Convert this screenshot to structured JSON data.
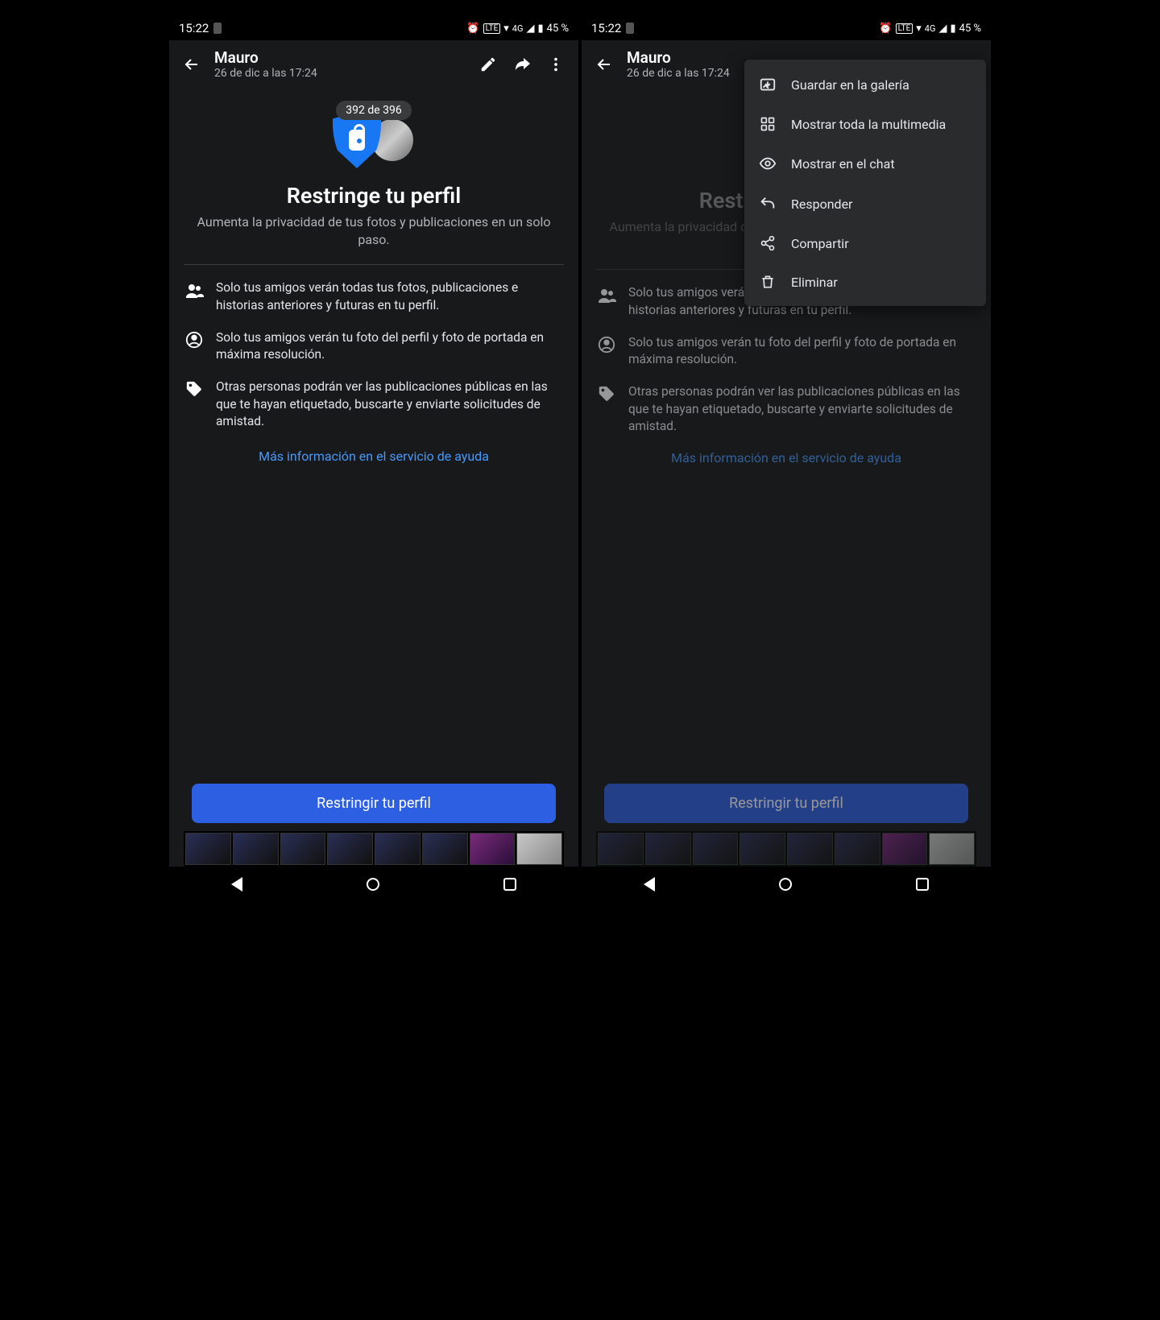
{
  "status": {
    "time": "15:22",
    "lte": "LTE",
    "net": "4G",
    "battery": "45 %"
  },
  "header": {
    "title": "Mauro",
    "subtitle": "26 de dic a las 17:24"
  },
  "counter": "392 de 396",
  "restrict": {
    "title": "Restringe tu perfil",
    "subtitle": "Aumenta la privacidad de tus fotos y publicaciones en un solo paso.",
    "bullets": [
      "Solo tus amigos verán todas tus fotos, publicaciones e historias anteriores y futuras en tu perfil.",
      "Solo tus amigos verán tu foto del perfil y foto de portada en máxima resolución.",
      "Otras personas podrán ver las publicaciones públicas en las que te hayan etiquetado, buscarte y enviarte solicitudes de amistad."
    ],
    "help_link": "Más información en el servicio de ayuda",
    "cta": "Restringir tu perfil"
  },
  "menu": {
    "items": [
      "Guardar en la galería",
      "Mostrar toda la multimedia",
      "Mostrar en el chat",
      "Responder",
      "Compartir",
      "Eliminar"
    ]
  }
}
